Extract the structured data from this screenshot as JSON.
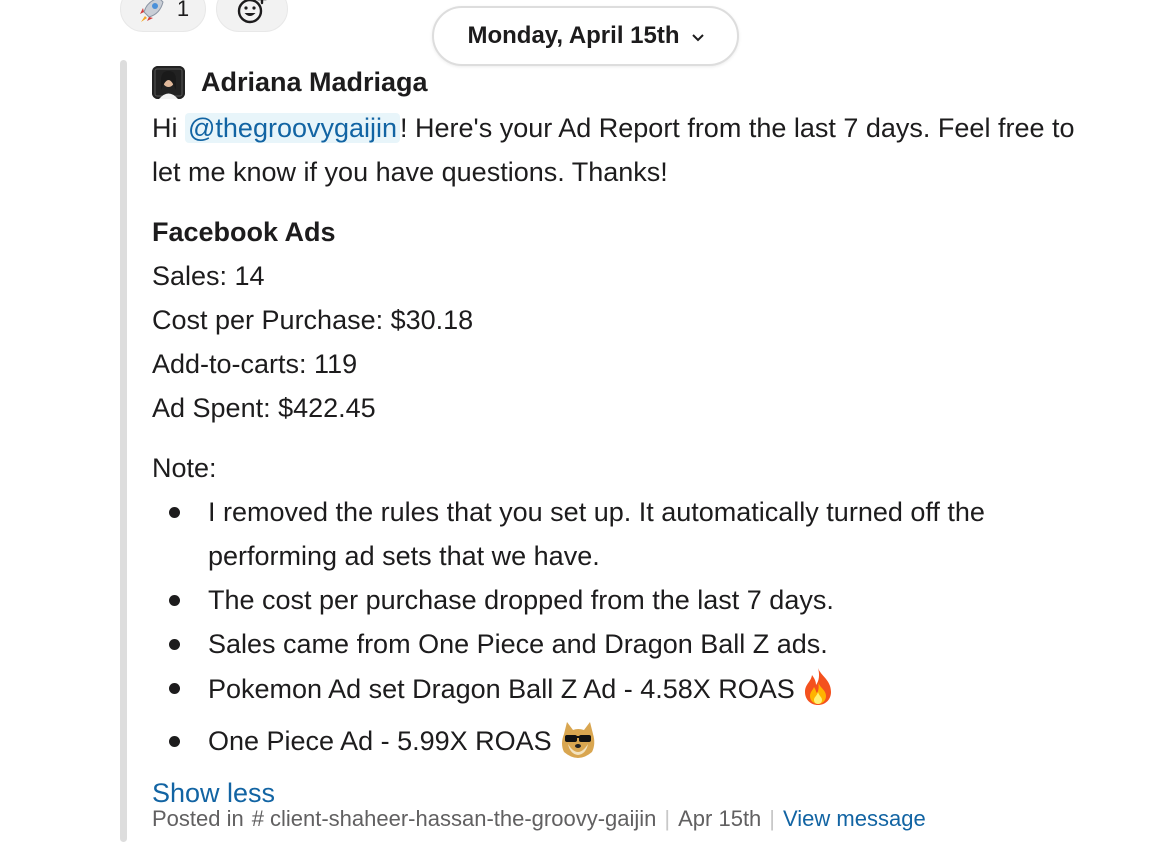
{
  "reactions": [
    {
      "icon": "rocket-icon",
      "count": "1"
    },
    {
      "icon": "add-reaction-icon"
    }
  ],
  "date_divider": {
    "label": "Monday, April 15th",
    "icon": "chevron-down-icon"
  },
  "message": {
    "author": "Adriana Madriaga",
    "greeting_pre": "Hi ",
    "mention": "@thegroovygaijin",
    "greeting_post": "! Here's your Ad Report from the last 7 days. Feel free to let me know if you have questions. Thanks!",
    "section_title": "Facebook Ads",
    "stats": [
      "Sales: 14",
      "Cost per Purchase: $30.18",
      "Add-to-carts: 119",
      "Ad Spent: $422.45"
    ],
    "note_label": "Note:",
    "notes": [
      "I removed the rules that you set up. It automatically turned off the performing ad sets that we have.",
      "The cost per purchase dropped from the last 7 days.",
      "Sales came from One Piece and Dragon Ball Z ads.",
      "Pokemon Ad set Dragon Ball Z Ad - 4.58X ROAS",
      "One Piece Ad - 5.99X ROAS"
    ],
    "note_emojis": {
      "fire": "fire-emoji",
      "doge": "doge-sunglasses-emoji"
    },
    "show_less": "Show less"
  },
  "footer": {
    "posted_in": "Posted in",
    "channel_hash": "#",
    "channel": "client-shaheer-hassan-the-groovy-gaijin",
    "date": "Apr 15th",
    "view_message": "View message"
  },
  "colors": {
    "link": "#1264a3",
    "mention_bg": "#e8f5fa",
    "quote_bar": "#dddddd",
    "text": "#1d1c1d",
    "muted": "#616061"
  }
}
